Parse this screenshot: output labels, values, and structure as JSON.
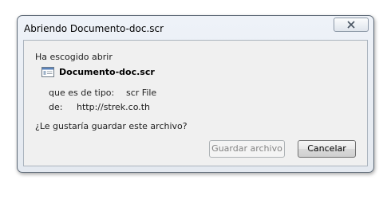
{
  "dialog": {
    "title": "Abriendo Documento-doc.scr",
    "intro": "Ha escogido abrir",
    "file_name": "Documento-doc.scr",
    "type_label": "que es de tipo:",
    "type_value": "scr File",
    "from_label": "de:",
    "from_value": "http://strek.co.th",
    "question": "¿Le gustaría guardar este archivo?",
    "save_button": "Guardar archivo",
    "cancel_button": "Cancelar",
    "file_icon": "application-file-icon",
    "close_icon": "close-icon"
  }
}
